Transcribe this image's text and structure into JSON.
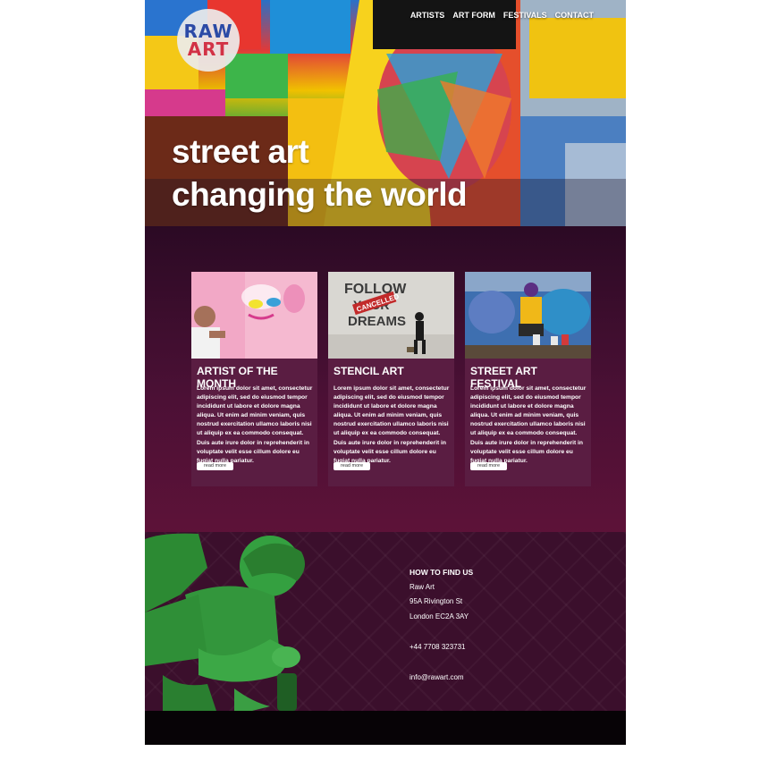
{
  "logo": {
    "line1": "RAW",
    "line2": "ART"
  },
  "nav": [
    "ARTISTS",
    "ART FORM",
    "FESTIVALS",
    "CONTACT"
  ],
  "hero": {
    "title_line1": "street art",
    "title_line2": "changing the world"
  },
  "cards": [
    {
      "title": "ARTIST OF THE MONTH",
      "body": "Lorem ipsum dolor sit amet, consectetur adipiscing elit, sed do eiusmod tempor incididunt ut labore et dolore magna aliqua. Ut enim ad minim veniam, quis nostrud exercitation ullamco laboris nisi ut aliquip ex ea commodo consequat. Duis aute irure dolor in reprehenderit in voluptate velit esse cillum dolore eu fugiat nulla pariatur.",
      "button": "read more"
    },
    {
      "title": "STENCIL ART",
      "image_text": [
        "FOLLOW",
        "YOUR",
        "DREAMS",
        "CANCELLED"
      ],
      "body": "Lorem ipsum dolor sit amet, consectetur adipiscing elit, sed do eiusmod tempor incididunt ut labore et dolore magna aliqua. Ut enim ad minim veniam, quis nostrud exercitation ullamco laboris nisi ut aliquip ex ea commodo consequat. Duis aute irure dolor in reprehenderit in voluptate velit esse cillum dolore eu fugiat nulla pariatur.",
      "button": "read more"
    },
    {
      "title": "STREET ART FESTIVAL",
      "body": "Lorem ipsum dolor sit amet, consectetur adipiscing elit, sed do eiusmod tempor incididunt ut labore et dolore magna aliqua. Ut enim ad minim veniam, quis nostrud exercitation ullamco laboris nisi ut aliquip ex ea commodo consequat. Duis aute irure dolor in reprehenderit in voluptate velit esse cillum dolore eu fugiat nulla pariatur.",
      "button": "read more"
    }
  ],
  "footer": {
    "heading": "HOW TO FIND US",
    "name": "Raw Art",
    "street": "95A Rivington St",
    "city": "London EC2A 3AY",
    "phone": "+44 7708 323731",
    "email": "info@rawart.com"
  },
  "colors": {
    "accent": "#5a1d42",
    "footer_bg": "#3b0f2c",
    "figure_green": "#2f9a3a"
  }
}
